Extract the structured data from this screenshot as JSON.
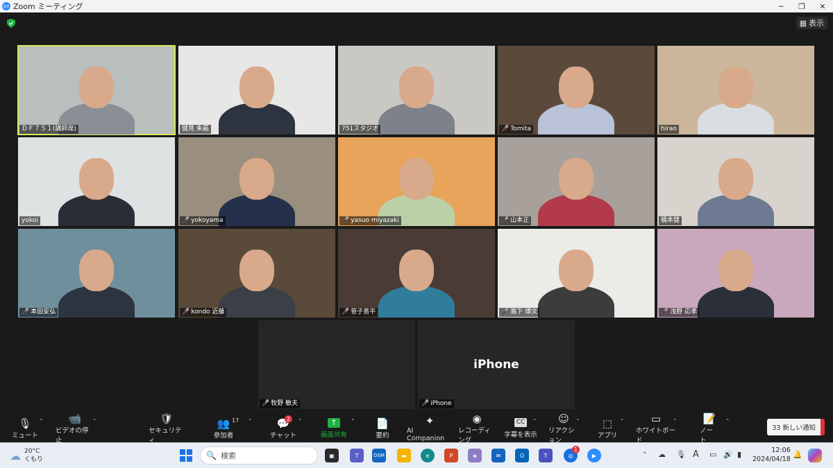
{
  "window": {
    "title": "Zoom ミーティング"
  },
  "top": {
    "view_label": "表示"
  },
  "participants": [
    {
      "name": "ＤＦ７５１(講師席)",
      "muted": false,
      "bg": "#b9bfbd",
      "shirt": "#8a8f96",
      "active": true
    },
    {
      "name": "健見 朱勗",
      "muted": false,
      "bg": "#e7e7e5",
      "shirt": "#2e3340"
    },
    {
      "name": "751スタジオ",
      "muted": false,
      "bg": "#c9c8c2",
      "shirt": "#7d828a"
    },
    {
      "name": "Tomita",
      "muted": true,
      "bg": "#5b4a3c",
      "shirt": "#b9c2d6"
    },
    {
      "name": "hirao",
      "muted": false,
      "bg": "#cbb69c",
      "shirt": "#d9dde2"
    },
    {
      "name": "yokoi",
      "muted": false,
      "bg": "#dfe2e3",
      "shirt": "#2a2d35"
    },
    {
      "name": "yokoyama",
      "muted": true,
      "bg": "#9a8e7e",
      "shirt": "#25304a"
    },
    {
      "name": "yasuo miyazaki",
      "muted": true,
      "bg": "#e7a45a",
      "shirt": "#bcd0a8"
    },
    {
      "name": "山本正",
      "muted": true,
      "bg": "#a7a09b",
      "shirt": "#b23a4a"
    },
    {
      "name": "橋本健",
      "muted": false,
      "bg": "#d8d3cc",
      "shirt": "#6d7a92"
    },
    {
      "name": "本田安弘",
      "muted": true,
      "bg": "#6f8f9d",
      "shirt": "#2d3440"
    },
    {
      "name": "kondo 近藤",
      "muted": true,
      "bg": "#5a4a3a",
      "shirt": "#3b3f47"
    },
    {
      "name": "笹子善平",
      "muted": true,
      "bg": "#4a3c34",
      "shirt": "#2f7d9a"
    },
    {
      "name": "嶌下 博文",
      "muted": true,
      "bg": "#ebebe8",
      "shirt": "#3c3c3c"
    },
    {
      "name": "浅野 応孝",
      "muted": true,
      "bg": "#c9a7bd",
      "shirt": "#2b2f3a"
    },
    {
      "name": "牧野 敏夫",
      "muted": true,
      "bg": "#262626",
      "shirt": "",
      "video": false
    },
    {
      "name": "iPhone",
      "muted": true,
      "bg": "#262626",
      "shirt": "",
      "video": false,
      "display_name": "iPhone"
    }
  ],
  "toolbar": {
    "mute": "ミュート",
    "video": "ビデオの停止",
    "security": "セキュリティ",
    "participants": "参加者",
    "participants_count": "17",
    "chat": "チャット",
    "chat_badge": "2",
    "share": "画面共有",
    "summary": "要約",
    "ai": "AI Companion",
    "record": "レコーディング",
    "captions": "字幕を表示",
    "reactions": "リアクション",
    "apps": "アプリ",
    "whiteboard": "ホワイトボード",
    "notes": "ノート",
    "notify": "33 新しい通知"
  },
  "taskbar": {
    "weather_temp": "20°C",
    "weather_desc": "くもり",
    "search_placeholder": "検索",
    "time": "12:06",
    "date": "2024/04/18",
    "dsm_label": "DSM",
    "zoom_badge": "1"
  },
  "colors": {
    "accent_green": "#1fb141",
    "mute_red": "#e0323b",
    "active_border": "#d8e65c"
  }
}
